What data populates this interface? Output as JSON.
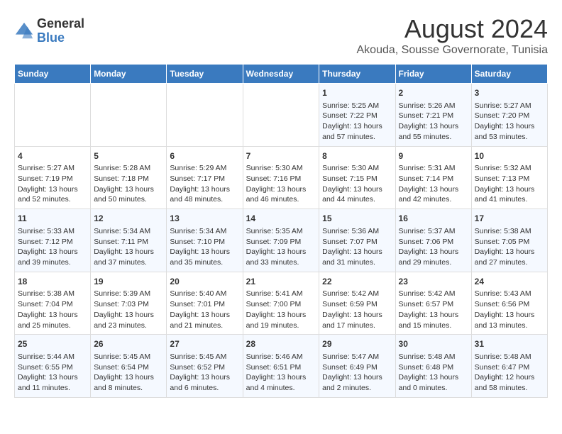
{
  "logo": {
    "general": "General",
    "blue": "Blue"
  },
  "title": "August 2024",
  "location": "Akouda, Sousse Governorate, Tunisia",
  "days_of_week": [
    "Sunday",
    "Monday",
    "Tuesday",
    "Wednesday",
    "Thursday",
    "Friday",
    "Saturday"
  ],
  "weeks": [
    [
      {
        "day": "",
        "info": ""
      },
      {
        "day": "",
        "info": ""
      },
      {
        "day": "",
        "info": ""
      },
      {
        "day": "",
        "info": ""
      },
      {
        "day": "1",
        "info": "Sunrise: 5:25 AM\nSunset: 7:22 PM\nDaylight: 13 hours and 57 minutes."
      },
      {
        "day": "2",
        "info": "Sunrise: 5:26 AM\nSunset: 7:21 PM\nDaylight: 13 hours and 55 minutes."
      },
      {
        "day": "3",
        "info": "Sunrise: 5:27 AM\nSunset: 7:20 PM\nDaylight: 13 hours and 53 minutes."
      }
    ],
    [
      {
        "day": "4",
        "info": "Sunrise: 5:27 AM\nSunset: 7:19 PM\nDaylight: 13 hours and 52 minutes."
      },
      {
        "day": "5",
        "info": "Sunrise: 5:28 AM\nSunset: 7:18 PM\nDaylight: 13 hours and 50 minutes."
      },
      {
        "day": "6",
        "info": "Sunrise: 5:29 AM\nSunset: 7:17 PM\nDaylight: 13 hours and 48 minutes."
      },
      {
        "day": "7",
        "info": "Sunrise: 5:30 AM\nSunset: 7:16 PM\nDaylight: 13 hours and 46 minutes."
      },
      {
        "day": "8",
        "info": "Sunrise: 5:30 AM\nSunset: 7:15 PM\nDaylight: 13 hours and 44 minutes."
      },
      {
        "day": "9",
        "info": "Sunrise: 5:31 AM\nSunset: 7:14 PM\nDaylight: 13 hours and 42 minutes."
      },
      {
        "day": "10",
        "info": "Sunrise: 5:32 AM\nSunset: 7:13 PM\nDaylight: 13 hours and 41 minutes."
      }
    ],
    [
      {
        "day": "11",
        "info": "Sunrise: 5:33 AM\nSunset: 7:12 PM\nDaylight: 13 hours and 39 minutes."
      },
      {
        "day": "12",
        "info": "Sunrise: 5:34 AM\nSunset: 7:11 PM\nDaylight: 13 hours and 37 minutes."
      },
      {
        "day": "13",
        "info": "Sunrise: 5:34 AM\nSunset: 7:10 PM\nDaylight: 13 hours and 35 minutes."
      },
      {
        "day": "14",
        "info": "Sunrise: 5:35 AM\nSunset: 7:09 PM\nDaylight: 13 hours and 33 minutes."
      },
      {
        "day": "15",
        "info": "Sunrise: 5:36 AM\nSunset: 7:07 PM\nDaylight: 13 hours and 31 minutes."
      },
      {
        "day": "16",
        "info": "Sunrise: 5:37 AM\nSunset: 7:06 PM\nDaylight: 13 hours and 29 minutes."
      },
      {
        "day": "17",
        "info": "Sunrise: 5:38 AM\nSunset: 7:05 PM\nDaylight: 13 hours and 27 minutes."
      }
    ],
    [
      {
        "day": "18",
        "info": "Sunrise: 5:38 AM\nSunset: 7:04 PM\nDaylight: 13 hours and 25 minutes."
      },
      {
        "day": "19",
        "info": "Sunrise: 5:39 AM\nSunset: 7:03 PM\nDaylight: 13 hours and 23 minutes."
      },
      {
        "day": "20",
        "info": "Sunrise: 5:40 AM\nSunset: 7:01 PM\nDaylight: 13 hours and 21 minutes."
      },
      {
        "day": "21",
        "info": "Sunrise: 5:41 AM\nSunset: 7:00 PM\nDaylight: 13 hours and 19 minutes."
      },
      {
        "day": "22",
        "info": "Sunrise: 5:42 AM\nSunset: 6:59 PM\nDaylight: 13 hours and 17 minutes."
      },
      {
        "day": "23",
        "info": "Sunrise: 5:42 AM\nSunset: 6:57 PM\nDaylight: 13 hours and 15 minutes."
      },
      {
        "day": "24",
        "info": "Sunrise: 5:43 AM\nSunset: 6:56 PM\nDaylight: 13 hours and 13 minutes."
      }
    ],
    [
      {
        "day": "25",
        "info": "Sunrise: 5:44 AM\nSunset: 6:55 PM\nDaylight: 13 hours and 11 minutes."
      },
      {
        "day": "26",
        "info": "Sunrise: 5:45 AM\nSunset: 6:54 PM\nDaylight: 13 hours and 8 minutes."
      },
      {
        "day": "27",
        "info": "Sunrise: 5:45 AM\nSunset: 6:52 PM\nDaylight: 13 hours and 6 minutes."
      },
      {
        "day": "28",
        "info": "Sunrise: 5:46 AM\nSunset: 6:51 PM\nDaylight: 13 hours and 4 minutes."
      },
      {
        "day": "29",
        "info": "Sunrise: 5:47 AM\nSunset: 6:49 PM\nDaylight: 13 hours and 2 minutes."
      },
      {
        "day": "30",
        "info": "Sunrise: 5:48 AM\nSunset: 6:48 PM\nDaylight: 13 hours and 0 minutes."
      },
      {
        "day": "31",
        "info": "Sunrise: 5:48 AM\nSunset: 6:47 PM\nDaylight: 12 hours and 58 minutes."
      }
    ]
  ]
}
